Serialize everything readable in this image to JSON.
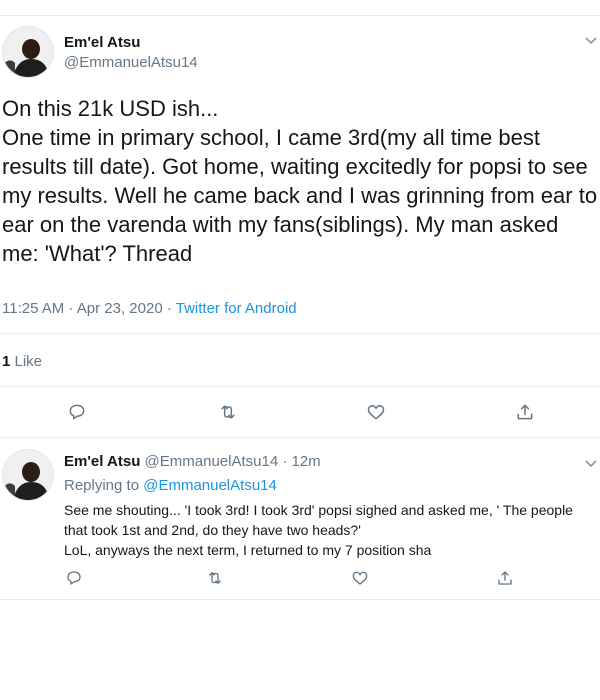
{
  "main_tweet": {
    "display_name": "Em'el Atsu",
    "handle": "@EmmanuelAtsu14",
    "text": "On this 21k USD ish...\nOne time in primary school, I came 3rd(my all time best results till date). Got home, waiting excitedly for popsi to see my results. Well he came back and I was grinning from ear to ear on the varenda with my fans(siblings). My man asked me: 'What'? Thread",
    "timestamp": "11:25 AM · Apr 23, 2020",
    "separator": " · ",
    "source": "Twitter for Android",
    "likes_count": "1",
    "likes_label": " Like"
  },
  "reply_tweet": {
    "display_name": "Em'el Atsu",
    "handle_time": "@EmmanuelAtsu14 · 12m",
    "replying_prefix": "Replying to ",
    "replying_to": "@EmmanuelAtsu14",
    "text_line1": "See me shouting... 'I took 3rd! I took 3rd' popsi sighed and asked me, ' The people that took 1st and 2nd, do they have two heads?'",
    "text_line2": "LoL, anyways the next term, I returned to my 7 position sha"
  },
  "icons": {
    "reply": "reply-icon",
    "retweet": "retweet-icon",
    "like": "heart-icon",
    "share": "share-icon",
    "menu": "chevron-down-icon"
  },
  "colors": {
    "link": "#1b95e0",
    "secondary_text": "#657786",
    "primary_text": "#14171a",
    "divider": "#e6ecf0"
  }
}
